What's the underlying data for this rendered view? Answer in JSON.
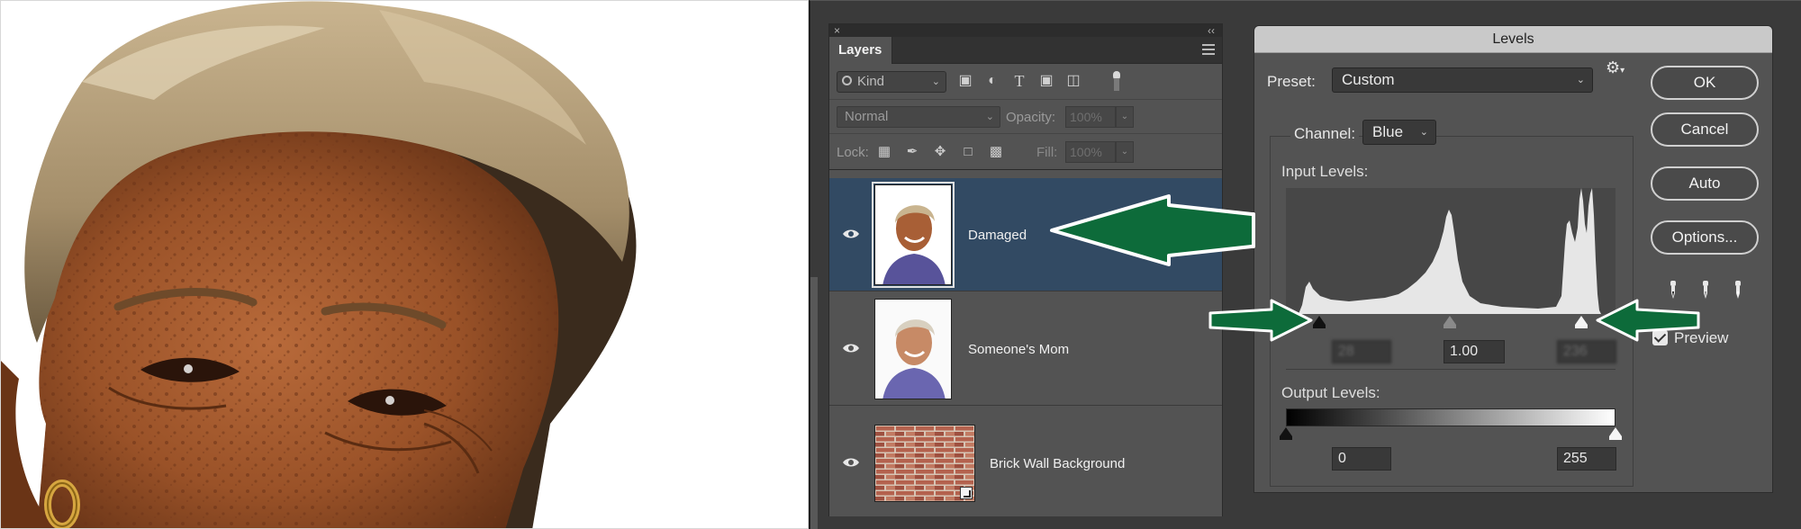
{
  "layers_panel": {
    "close_glyph": "×",
    "collapse_glyph": "‹‹",
    "tab_label": "Layers",
    "filter_kind": "Kind",
    "blend_mode": "Normal",
    "opacity_label": "Opacity:",
    "opacity_value": "100%",
    "lock_label": "Lock:",
    "fill_label": "Fill:",
    "fill_value": "100%",
    "layers": [
      {
        "name": "Damaged",
        "selected": true
      },
      {
        "name": "Someone's Mom",
        "selected": false
      },
      {
        "name": "Brick Wall Background",
        "selected": false
      }
    ]
  },
  "levels_dialog": {
    "title": "Levels",
    "preset_label": "Preset:",
    "preset_value": "Custom",
    "channel_label": "Channel:",
    "channel_value": "Blue",
    "input_levels_label": "Input Levels:",
    "input_black": "28",
    "input_midtone": "1.00",
    "input_white": "236",
    "output_levels_label": "Output Levels:",
    "output_black": "0",
    "output_white": "255",
    "buttons": {
      "ok": "OK",
      "cancel": "Cancel",
      "auto": "Auto",
      "options": "Options..."
    },
    "preview_label": "Preview",
    "preview_checked": true
  },
  "icons": [
    "close-icon",
    "collapse-icon",
    "panel-menu-icon",
    "search-icon",
    "image-filter-icon",
    "adjustment-filter-icon",
    "type-filter-icon",
    "shape-filter-icon",
    "smart-object-filter-icon",
    "lock-transparent-icon",
    "lock-brush-icon",
    "lock-move-icon",
    "lock-artboard-icon",
    "lock-all-icon",
    "eye-icon",
    "gear-icon",
    "black-eyedropper-icon",
    "gray-eyedropper-icon",
    "white-eyedropper-icon",
    "checkbox-icon",
    "smart-object-badge-icon"
  ],
  "colors": {
    "selected_layer": "#324a63",
    "annotation_arrow": "#0d6b3a",
    "panel_bg": "#535353",
    "dialog_title_bg": "#c9c9c9"
  }
}
